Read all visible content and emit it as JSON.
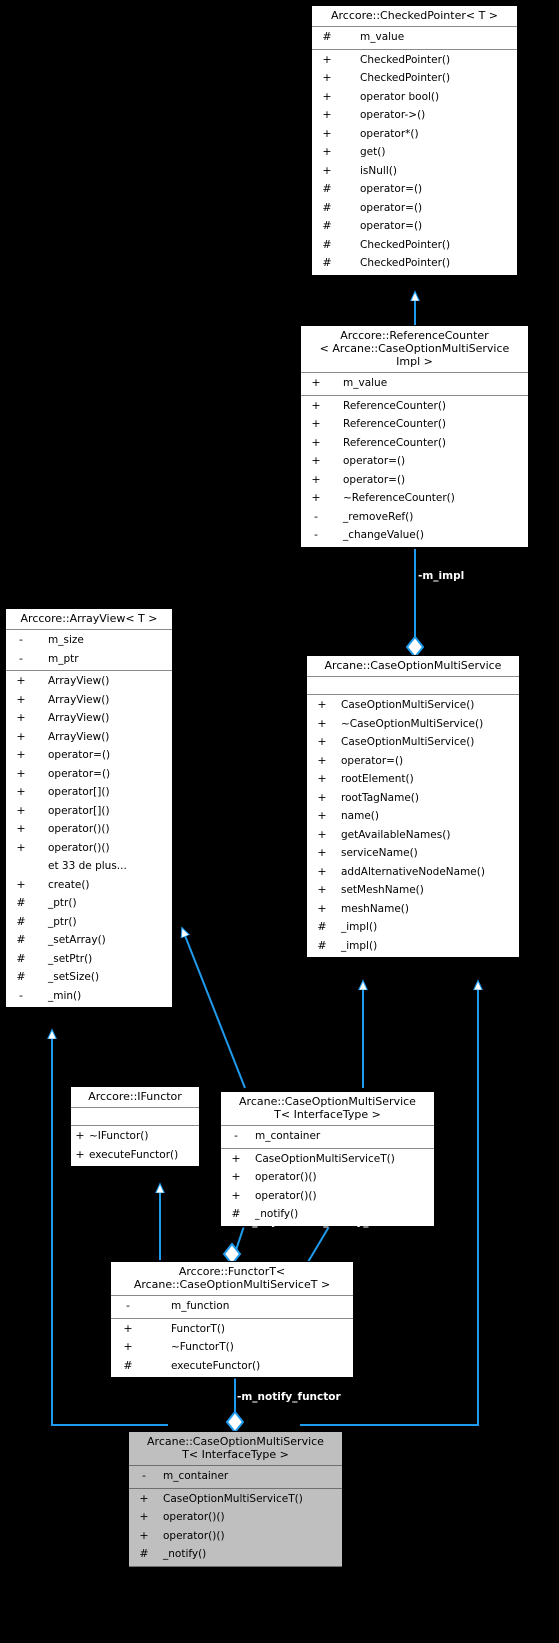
{
  "diagram": {
    "title": "Arcane::CaseOptionMultiServiceT< InterfaceType > collaboration diagram",
    "type": "uml-class-collaboration",
    "bg_color": "#000000",
    "node_fill": "#ffffff",
    "highlight_fill": "#bfbfbf",
    "edge_color": "#1f9bee",
    "label_color": "#ffffff"
  },
  "nodes": [
    {
      "id": "checked_pointer",
      "title": "Arccore::CheckedPointer< T >",
      "highlighted": false,
      "attributes": [
        {
          "vis": "#",
          "name": "m_value"
        }
      ],
      "methods": [
        {
          "vis": "+",
          "name": "CheckedPointer()"
        },
        {
          "vis": "+",
          "name": "CheckedPointer()"
        },
        {
          "vis": "+",
          "name": "operator bool()"
        },
        {
          "vis": "+",
          "name": "operator->()"
        },
        {
          "vis": "+",
          "name": "operator*()"
        },
        {
          "vis": "+",
          "name": "get()"
        },
        {
          "vis": "+",
          "name": "isNull()"
        },
        {
          "vis": "#",
          "name": "operator=()"
        },
        {
          "vis": "#",
          "name": "operator=()"
        },
        {
          "vis": "#",
          "name": "operator=()"
        },
        {
          "vis": "#",
          "name": "CheckedPointer()"
        },
        {
          "vis": "#",
          "name": "CheckedPointer()"
        }
      ]
    },
    {
      "id": "reference_counter",
      "title_lines": [
        "Arccore::ReferenceCounter",
        "< Arcane::CaseOptionMultiService",
        "Impl >"
      ],
      "highlighted": false,
      "attributes": [
        {
          "vis": "+",
          "name": "m_value"
        }
      ],
      "methods": [
        {
          "vis": "+",
          "name": "ReferenceCounter()"
        },
        {
          "vis": "+",
          "name": "ReferenceCounter()"
        },
        {
          "vis": "+",
          "name": "ReferenceCounter()"
        },
        {
          "vis": "+",
          "name": "operator=()"
        },
        {
          "vis": "+",
          "name": "operator=()"
        },
        {
          "vis": "+",
          "name": "~ReferenceCounter()"
        },
        {
          "vis": "-",
          "name": "_removeRef()"
        },
        {
          "vis": "-",
          "name": "_changeValue()"
        }
      ]
    },
    {
      "id": "array_view",
      "title": "Arccore::ArrayView< T >",
      "highlighted": false,
      "attributes": [
        {
          "vis": "-",
          "name": "m_size"
        },
        {
          "vis": "-",
          "name": "m_ptr"
        }
      ],
      "methods": [
        {
          "vis": "+",
          "name": "ArrayView()"
        },
        {
          "vis": "+",
          "name": "ArrayView()"
        },
        {
          "vis": "+",
          "name": "ArrayView()"
        },
        {
          "vis": "+",
          "name": "ArrayView()"
        },
        {
          "vis": "+",
          "name": "operator=()"
        },
        {
          "vis": "+",
          "name": "operator=()"
        },
        {
          "vis": "+",
          "name": "operator[]()"
        },
        {
          "vis": "+",
          "name": "operator[]()"
        },
        {
          "vis": "+",
          "name": "operator()()"
        },
        {
          "vis": "+",
          "name": "operator()()"
        },
        {
          "vis": "",
          "name": "et 33 de plus..."
        },
        {
          "vis": "+",
          "name": "create()"
        },
        {
          "vis": "#",
          "name": "_ptr()"
        },
        {
          "vis": "#",
          "name": "_ptr()"
        },
        {
          "vis": "#",
          "name": "_setArray()"
        },
        {
          "vis": "#",
          "name": "_setPtr()"
        },
        {
          "vis": "#",
          "name": "_setSize()"
        },
        {
          "vis": "-",
          "name": "_min()"
        }
      ]
    },
    {
      "id": "case_option_multi_service",
      "title": "Arcane::CaseOptionMultiService",
      "highlighted": false,
      "attributes": [],
      "methods": [
        {
          "vis": "+",
          "name": "CaseOptionMultiService()"
        },
        {
          "vis": "+",
          "name": "~CaseOptionMultiService()"
        },
        {
          "vis": "+",
          "name": "CaseOptionMultiService()"
        },
        {
          "vis": "+",
          "name": "operator=()"
        },
        {
          "vis": "+",
          "name": "rootElement()"
        },
        {
          "vis": "+",
          "name": "rootTagName()"
        },
        {
          "vis": "+",
          "name": "name()"
        },
        {
          "vis": "+",
          "name": "getAvailableNames()"
        },
        {
          "vis": "+",
          "name": "serviceName()"
        },
        {
          "vis": "+",
          "name": "addAlternativeNodeName()"
        },
        {
          "vis": "+",
          "name": "setMeshName()"
        },
        {
          "vis": "+",
          "name": "meshName()"
        },
        {
          "vis": "#",
          "name": "_impl()"
        },
        {
          "vis": "#",
          "name": "_impl()"
        }
      ]
    },
    {
      "id": "case_option_multi_service_t_mid",
      "title_lines": [
        "Arcane::CaseOptionMultiService",
        "T< InterfaceType >"
      ],
      "highlighted": false,
      "attributes": [
        {
          "vis": "-",
          "name": "m_container"
        }
      ],
      "methods": [
        {
          "vis": "+",
          "name": "CaseOptionMultiServiceT()"
        },
        {
          "vis": "+",
          "name": "operator()()"
        },
        {
          "vis": "+",
          "name": "operator()()"
        },
        {
          "vis": "#",
          "name": "_notify()"
        }
      ]
    },
    {
      "id": "ifunctor",
      "title": "Arccore::IFunctor",
      "highlighted": false,
      "attributes": [],
      "methods": [
        {
          "vis": "+",
          "name": "~IFunctor()"
        },
        {
          "vis": "+",
          "name": "executeFunctor()"
        }
      ]
    },
    {
      "id": "functor_t",
      "title_lines": [
        "Arccore::FunctorT<",
        "Arcane::CaseOptionMultiServiceT >"
      ],
      "highlighted": false,
      "attributes": [
        {
          "vis": "-",
          "name": "m_function"
        }
      ],
      "methods": [
        {
          "vis": "+",
          "name": "FunctorT()"
        },
        {
          "vis": "+",
          "name": "~FunctorT()"
        },
        {
          "vis": "#",
          "name": "executeFunctor()"
        }
      ]
    },
    {
      "id": "case_option_multi_service_t_bottom",
      "title_lines": [
        "Arcane::CaseOptionMultiService",
        "T< InterfaceType >"
      ],
      "highlighted": true,
      "attributes": [
        {
          "vis": "-",
          "name": "m_container"
        }
      ],
      "methods": [
        {
          "vis": "+",
          "name": "CaseOptionMultiServiceT()"
        },
        {
          "vis": "+",
          "name": "operator()()"
        },
        {
          "vis": "+",
          "name": "operator()()"
        },
        {
          "vis": "#",
          "name": "_notify()"
        }
      ]
    }
  ],
  "edge_labels": [
    {
      "id": "m_impl",
      "text": "-m_impl"
    },
    {
      "id": "m_object",
      "text": "-m_object"
    },
    {
      "id": "m_notify_functor_mid",
      "text": "-m_notify_functor"
    },
    {
      "id": "m_notify_functor_bottom",
      "text": "-m_notify_functor"
    }
  ]
}
